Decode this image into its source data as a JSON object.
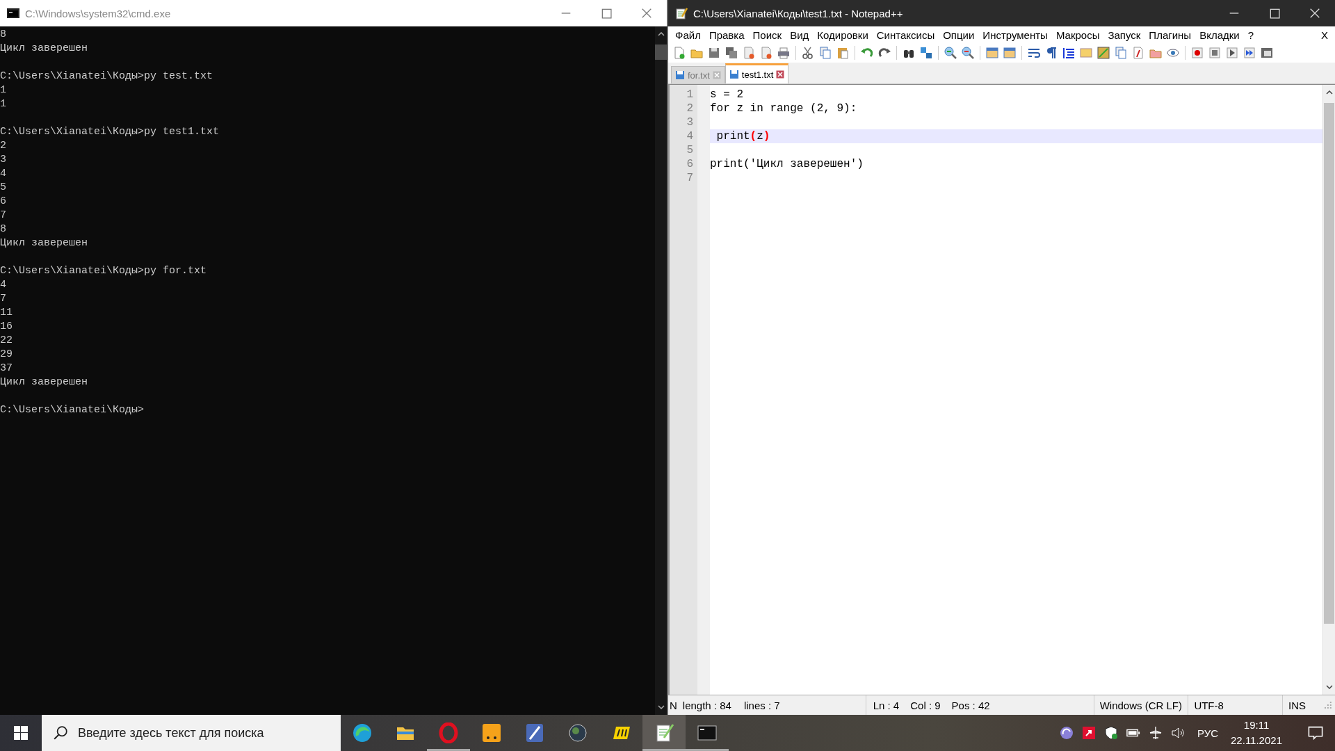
{
  "console_window": {
    "title": "C:\\Windows\\system32\\cmd.exe",
    "blocks": [
      [
        "8",
        "Цикл заверешен"
      ],
      [
        "C:\\Users\\Xianatei\\Коды>py test.txt",
        "1",
        "1"
      ],
      [
        "C:\\Users\\Xianatei\\Коды>py test1.txt",
        "2",
        "3",
        "4",
        "5",
        "6",
        "7",
        "8",
        "Цикл заверешен"
      ],
      [
        "C:\\Users\\Xianatei\\Коды>py for.txt",
        "4",
        "7",
        "11",
        "16",
        "22",
        "29",
        "37",
        "Цикл заверешен"
      ],
      [
        "C:\\Users\\Xianatei\\Коды>"
      ]
    ]
  },
  "editor_window": {
    "title": "C:\\Users\\Xianatei\\Коды\\test1.txt - Notepad++",
    "menu": [
      "Файл",
      "Правка",
      "Поиск",
      "Вид",
      "Кодировки",
      "Синтаксисы",
      "Опции",
      "Инструменты",
      "Макросы",
      "Запуск",
      "Плагины",
      "Вкладки",
      "?"
    ],
    "menu_close": "X",
    "tabs": [
      {
        "label": "for.txt",
        "selected": false
      },
      {
        "label": "test1.txt",
        "selected": true
      }
    ],
    "lines": [
      {
        "number": "1",
        "current": false,
        "segments": [
          {
            "kind": "plain",
            "text": "s = 2"
          }
        ]
      },
      {
        "number": "2",
        "current": false,
        "segments": [
          {
            "kind": "plain",
            "text": "for z in range (2, 9):"
          }
        ]
      },
      {
        "number": "3",
        "current": false
      },
      {
        "number": "4",
        "current": true,
        "segments": [
          {
            "kind": "plain",
            "text": " print"
          },
          {
            "kind": "brace",
            "text": "("
          },
          {
            "kind": "plain",
            "text": "z"
          },
          {
            "kind": "brace",
            "text": ")"
          }
        ]
      },
      {
        "number": "5",
        "current": false
      },
      {
        "number": "6",
        "current": false,
        "segments": [
          {
            "kind": "plain",
            "text": "print('Цикл заверешен')"
          }
        ]
      },
      {
        "number": "7",
        "current": false
      }
    ],
    "status_bar": [
      {
        "kind": "wide",
        "parts": [
          "N",
          "length : 84",
          "lines : 7"
        ]
      },
      {
        "kind": "wide",
        "parts": [
          "Ln : 4",
          "Col : 9",
          "Pos : 42"
        ]
      },
      {
        "kind": "mid",
        "parts": [
          "Windows (CR LF)"
        ]
      },
      {
        "kind": "mid",
        "parts": [
          "UTF-8"
        ]
      },
      {
        "kind": "small",
        "parts": [
          "INS"
        ]
      }
    ]
  },
  "taskbar": {
    "search": {
      "placeholder": "Введите здесь текст для поиска"
    },
    "apps": [
      {
        "kind": "edge",
        "running": false,
        "selected": false
      },
      {
        "kind": "folder",
        "running": false,
        "selected": false
      },
      {
        "kind": "opera",
        "running": true,
        "selected": false
      },
      {
        "kind": "orange",
        "running": false,
        "selected": false
      },
      {
        "kind": "game",
        "running": false,
        "selected": false
      },
      {
        "kind": "globe",
        "running": false,
        "selected": false
      },
      {
        "kind": "pdf",
        "running": false,
        "selected": false
      },
      {
        "kind": "notepad",
        "running": true,
        "selected": true
      },
      {
        "kind": "console",
        "running": true,
        "selected": false
      }
    ],
    "language": "РУС",
    "time": "19:11",
    "date": "22.11.2021"
  }
}
